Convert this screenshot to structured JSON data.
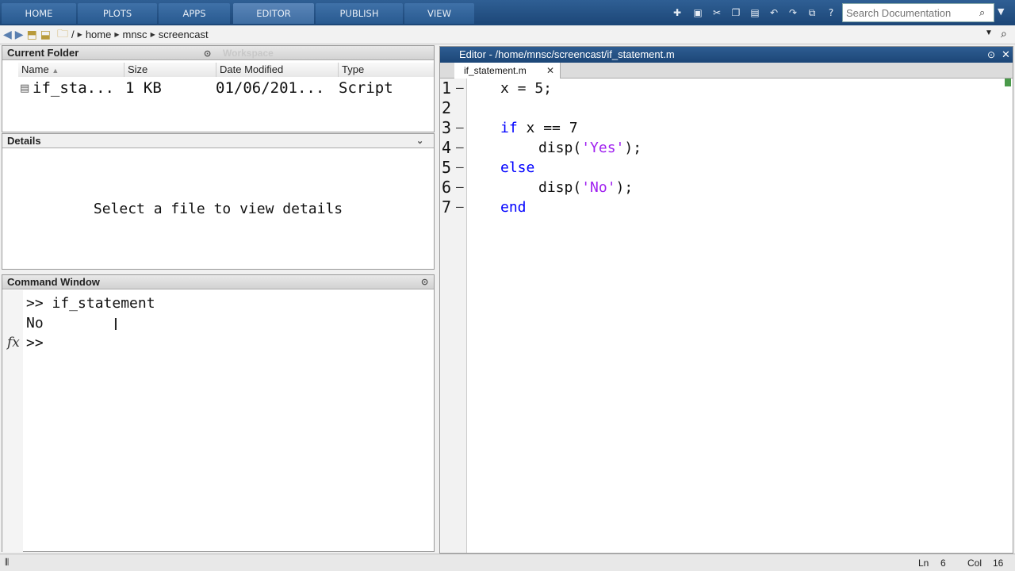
{
  "toolstrip": {
    "tabs": [
      "HOME",
      "PLOTS",
      "APPS",
      "EDITOR",
      "PUBLISH",
      "VIEW"
    ],
    "search_placeholder": "Search Documentation"
  },
  "address": {
    "root": "/",
    "crumbs": [
      "home",
      "mnsc",
      "screencast"
    ]
  },
  "current_folder": {
    "title": "Current Folder",
    "hidden_tab": "Workspace",
    "columns": [
      "Name",
      "Size",
      "Date Modified",
      "Type"
    ],
    "sort_indicator": "▲",
    "files": [
      {
        "name": "if_sta...",
        "size": "1 KB",
        "date": "01/06/201...",
        "type": "Script"
      }
    ]
  },
  "details": {
    "title": "Details",
    "message": "Select a file to view details"
  },
  "command_window": {
    "title": "Command Window",
    "lines": [
      ">> if_statement",
      "No",
      ">>"
    ],
    "fx": "fx"
  },
  "editor": {
    "title": "Editor - /home/mnsc/screencast/if_statement.m",
    "tab": "if_statement.m",
    "line_numbers": [
      "1",
      "2",
      "3",
      "4",
      "5",
      "6",
      "7"
    ]
  },
  "status": {
    "ln_label": "Ln",
    "ln": "6",
    "col_label": "Col",
    "col": "16"
  }
}
